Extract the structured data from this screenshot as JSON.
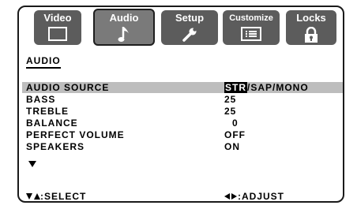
{
  "tabs": [
    {
      "label": "Video",
      "icon": "screen-icon"
    },
    {
      "label": "Audio",
      "icon": "music-note-icon",
      "active": true
    },
    {
      "label": "Setup",
      "icon": "wrench-icon"
    },
    {
      "label": "Customize",
      "icon": "list-icon"
    },
    {
      "label": "Locks",
      "icon": "padlock-icon"
    }
  ],
  "section_title": "AUDIO",
  "settings": [
    {
      "label": "AUDIO SOURCE",
      "options": {
        "selected": "STR",
        "rest": "/SAP/MONO"
      }
    },
    {
      "label": "BASS",
      "value": "25"
    },
    {
      "label": "TREBLE",
      "value": "25"
    },
    {
      "label": "BALANCE",
      "value": "0"
    },
    {
      "label": "PERFECT VOLUME",
      "value": "OFF"
    },
    {
      "label": "SPEAKERS",
      "value": "ON"
    }
  ],
  "footer": {
    "select_label": ":SELECT",
    "adjust_label": ":ADJUST"
  },
  "colors": {
    "tab_bg": "#5c5c5c",
    "tab_active_bg": "#7a7a7a",
    "highlight_row": "#bdbdbd",
    "text": "#000000"
  }
}
